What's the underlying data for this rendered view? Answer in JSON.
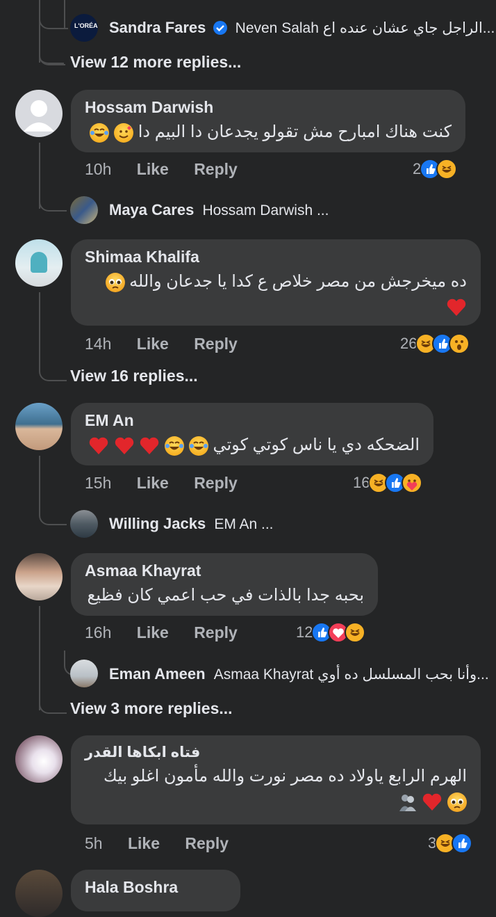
{
  "thread_top": {
    "reply_name": "Sandra Fares",
    "reply_verified": true,
    "reply_text": "Neven Salah الراجل جاي عشان عنده اع...",
    "view_more": "View 12 more replies..."
  },
  "comments": [
    {
      "name": "Hossam Darwish",
      "text": "كنت هناك امبارح مش تقولو يجدعان دا البيم دا",
      "time": "10h",
      "like": "Like",
      "reply": "Reply",
      "reaction_count": "2",
      "sub_reply": {
        "name": "Maya Cares",
        "text": "Hossam Darwish ..."
      }
    },
    {
      "name": "Shimaa Khalifa",
      "text": "ده ميخرجش من مصر خلاص ع كدا يا جدعان والله",
      "time": "14h",
      "like": "Like",
      "reply": "Reply",
      "reaction_count": "26",
      "view_more": "View 16 replies..."
    },
    {
      "name": "EM An",
      "text": "الضحكه دي يا ناس كوتي كوتي",
      "time": "15h",
      "like": "Like",
      "reply": "Reply",
      "reaction_count": "16",
      "sub_reply": {
        "name": "Willing Jacks",
        "text": "EM An ..."
      }
    },
    {
      "name": "Asmaa Khayrat",
      "text": "بحبه جدا بالذات في حب اعمي كان فظيع",
      "time": "16h",
      "like": "Like",
      "reply": "Reply",
      "reaction_count": "12",
      "sub_reply": {
        "name": "Eman Ameen",
        "text": "Asmaa Khayrat وأنا بحب المسلسل ده أوي..."
      },
      "view_more": "View 3 more replies..."
    },
    {
      "name": "فتاه ابكاها القدر",
      "text_line1": "الهرم الرابع ياولاد ده مصر نورت والله مأمون اغلو بيك",
      "time": "5h",
      "like": "Like",
      "reply": "Reply",
      "reaction_count": "3"
    },
    {
      "name": "Hala Boshra"
    }
  ],
  "colors": {
    "background": "#242526",
    "bubble": "#3a3b3c",
    "like_blue": "#1877f2",
    "love_red": "#f33e58",
    "haha_yellow": "#f7b125"
  }
}
